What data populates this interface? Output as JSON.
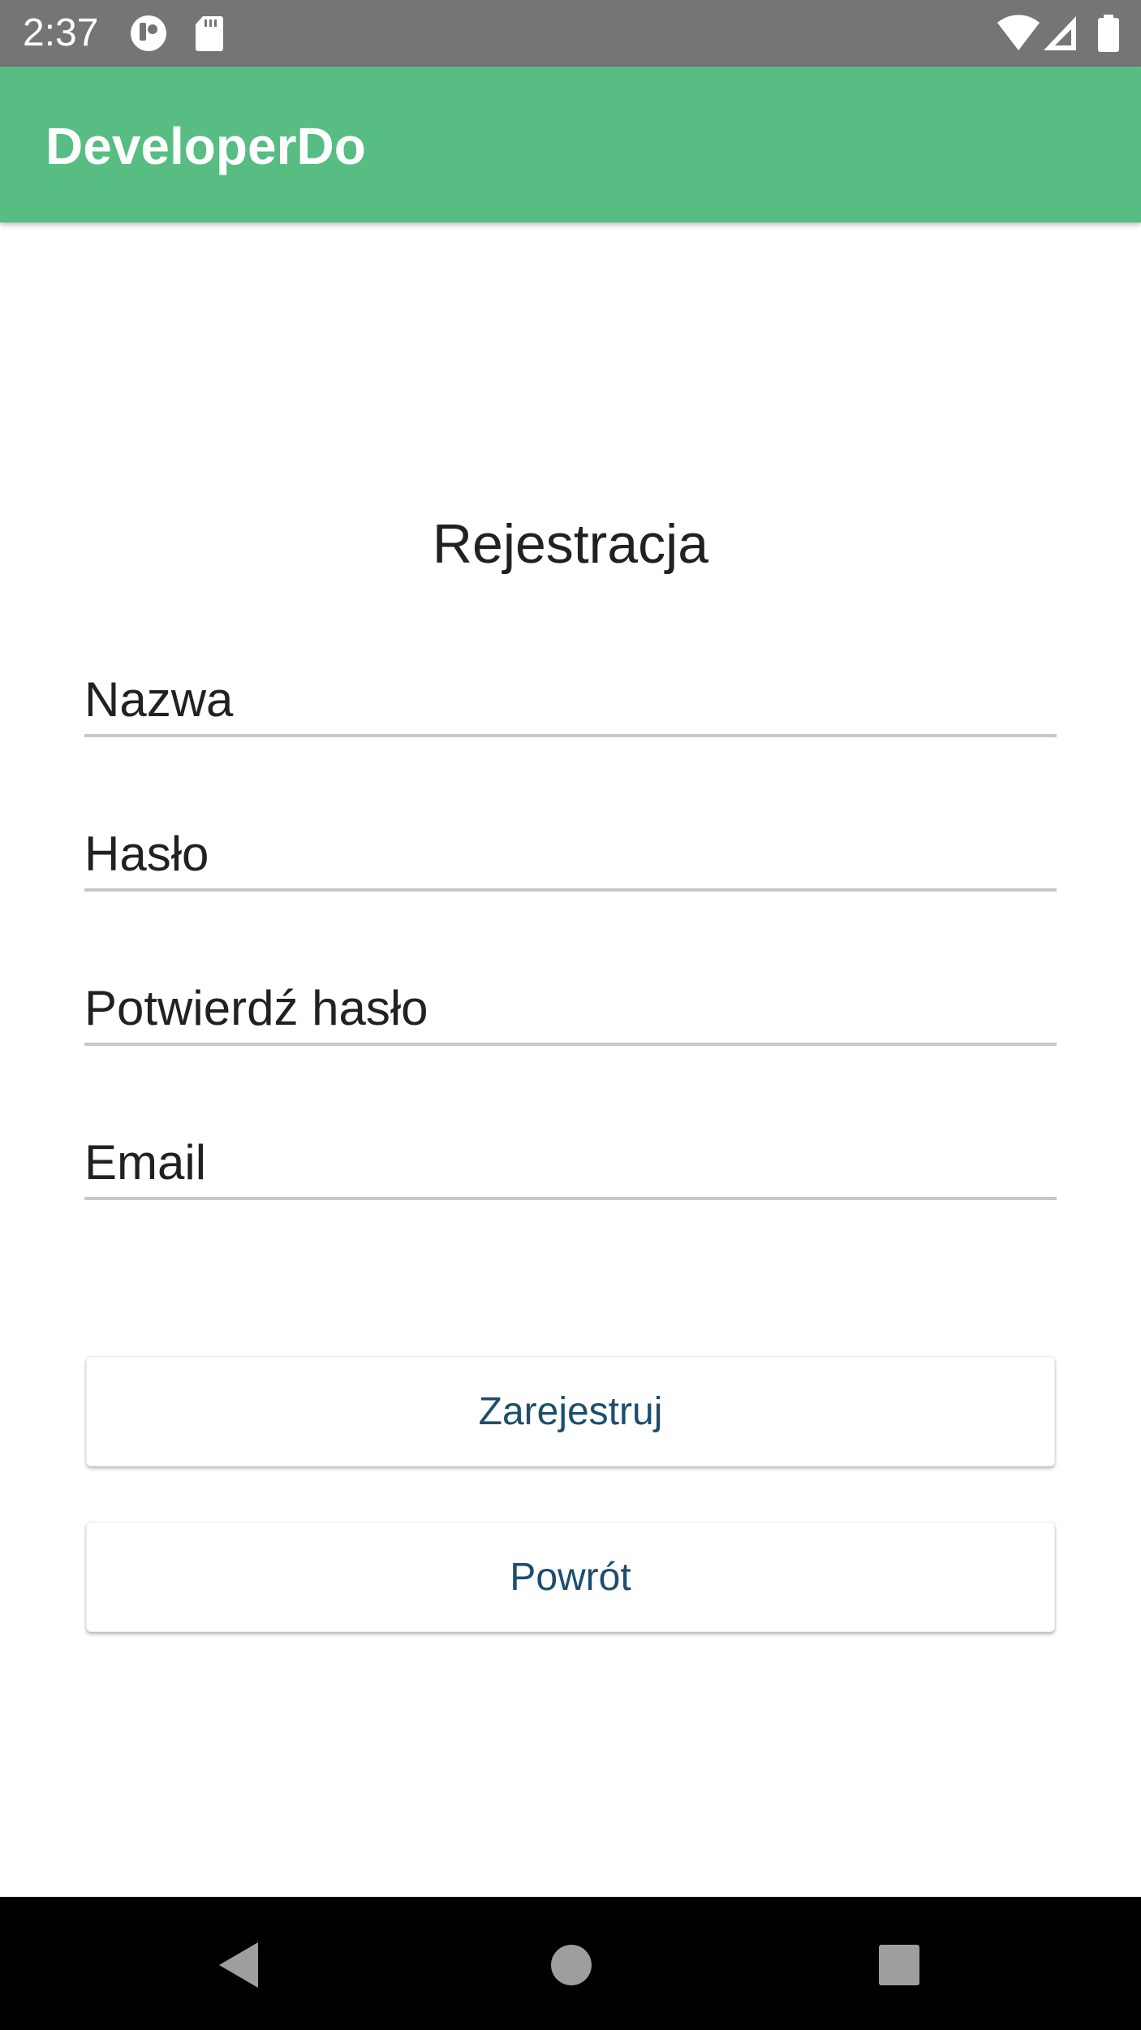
{
  "status_bar": {
    "time": "2:37",
    "icons_left": [
      "app-notification-icon",
      "sd-card-icon"
    ],
    "icons_right": [
      "wifi-icon",
      "signal-icon",
      "battery-icon"
    ],
    "background": "#757575"
  },
  "app_bar": {
    "title": "DeveloperDo",
    "background": "#57bd82"
  },
  "form": {
    "heading": "Rejestracja",
    "fields": [
      {
        "placeholder": "Nazwa",
        "value": ""
      },
      {
        "placeholder": "Hasło",
        "value": ""
      },
      {
        "placeholder": "Potwierdź hasło",
        "value": ""
      },
      {
        "placeholder": "Email",
        "value": ""
      }
    ],
    "register_label": "Zarejestruj",
    "back_label": "Powrót",
    "button_text_color": "#1d4e6e"
  },
  "nav_bar": {
    "icons": [
      "back-icon",
      "home-icon",
      "recents-icon"
    ]
  }
}
